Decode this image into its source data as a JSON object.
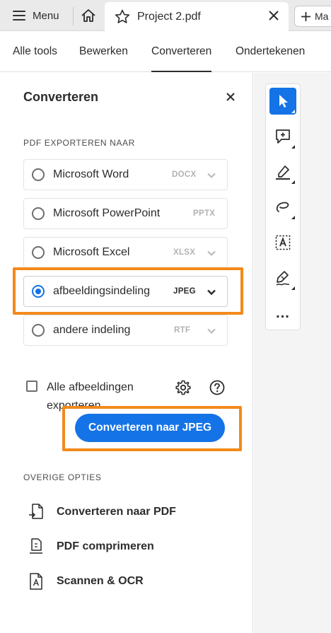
{
  "tabbar": {
    "menu_label": "Menu",
    "doc_title": "Project 2.pdf",
    "new_tab_label": "Ma"
  },
  "nav": {
    "items": [
      {
        "label": "Alle tools"
      },
      {
        "label": "Bewerken"
      },
      {
        "label": "Converteren",
        "active": true
      },
      {
        "label": "Ondertekenen"
      }
    ]
  },
  "panel": {
    "title": "Converteren",
    "export_section_label": "PDF EXPORTEREN NAAR",
    "options": [
      {
        "label": "Microsoft Word",
        "format": "DOCX",
        "selected": false
      },
      {
        "label": "Microsoft PowerPoint",
        "format": "PPTX",
        "selected": false
      },
      {
        "label": "Microsoft Excel",
        "format": "XLSX",
        "selected": false
      },
      {
        "label": "afbeeldingsindeling",
        "format": "JPEG",
        "selected": true
      },
      {
        "label": "andere indeling",
        "format": "RTF",
        "selected": false
      }
    ],
    "checkbox_label": "Alle afbeeldingen exporteren",
    "checkbox_checked": false,
    "convert_button": "Converteren naar JPEG",
    "other_section_label": "OVERIGE OPTIES",
    "other_options": [
      {
        "label": "Converteren naar PDF",
        "icon": "convert-to-pdf-icon"
      },
      {
        "label": "PDF comprimeren",
        "icon": "compress-pdf-icon"
      },
      {
        "label": "Scannen & OCR",
        "icon": "scan-ocr-icon"
      }
    ]
  },
  "toolbar": {
    "tools": [
      "select-pointer-icon",
      "add-comment-icon",
      "highlight-pen-icon",
      "draw-freeform-icon",
      "text-select-icon",
      "fill-sign-icon",
      "more-tools-icon"
    ],
    "more_label": "..."
  },
  "colors": {
    "accent": "#1473e6",
    "highlight_outline": "#f28a1c"
  }
}
